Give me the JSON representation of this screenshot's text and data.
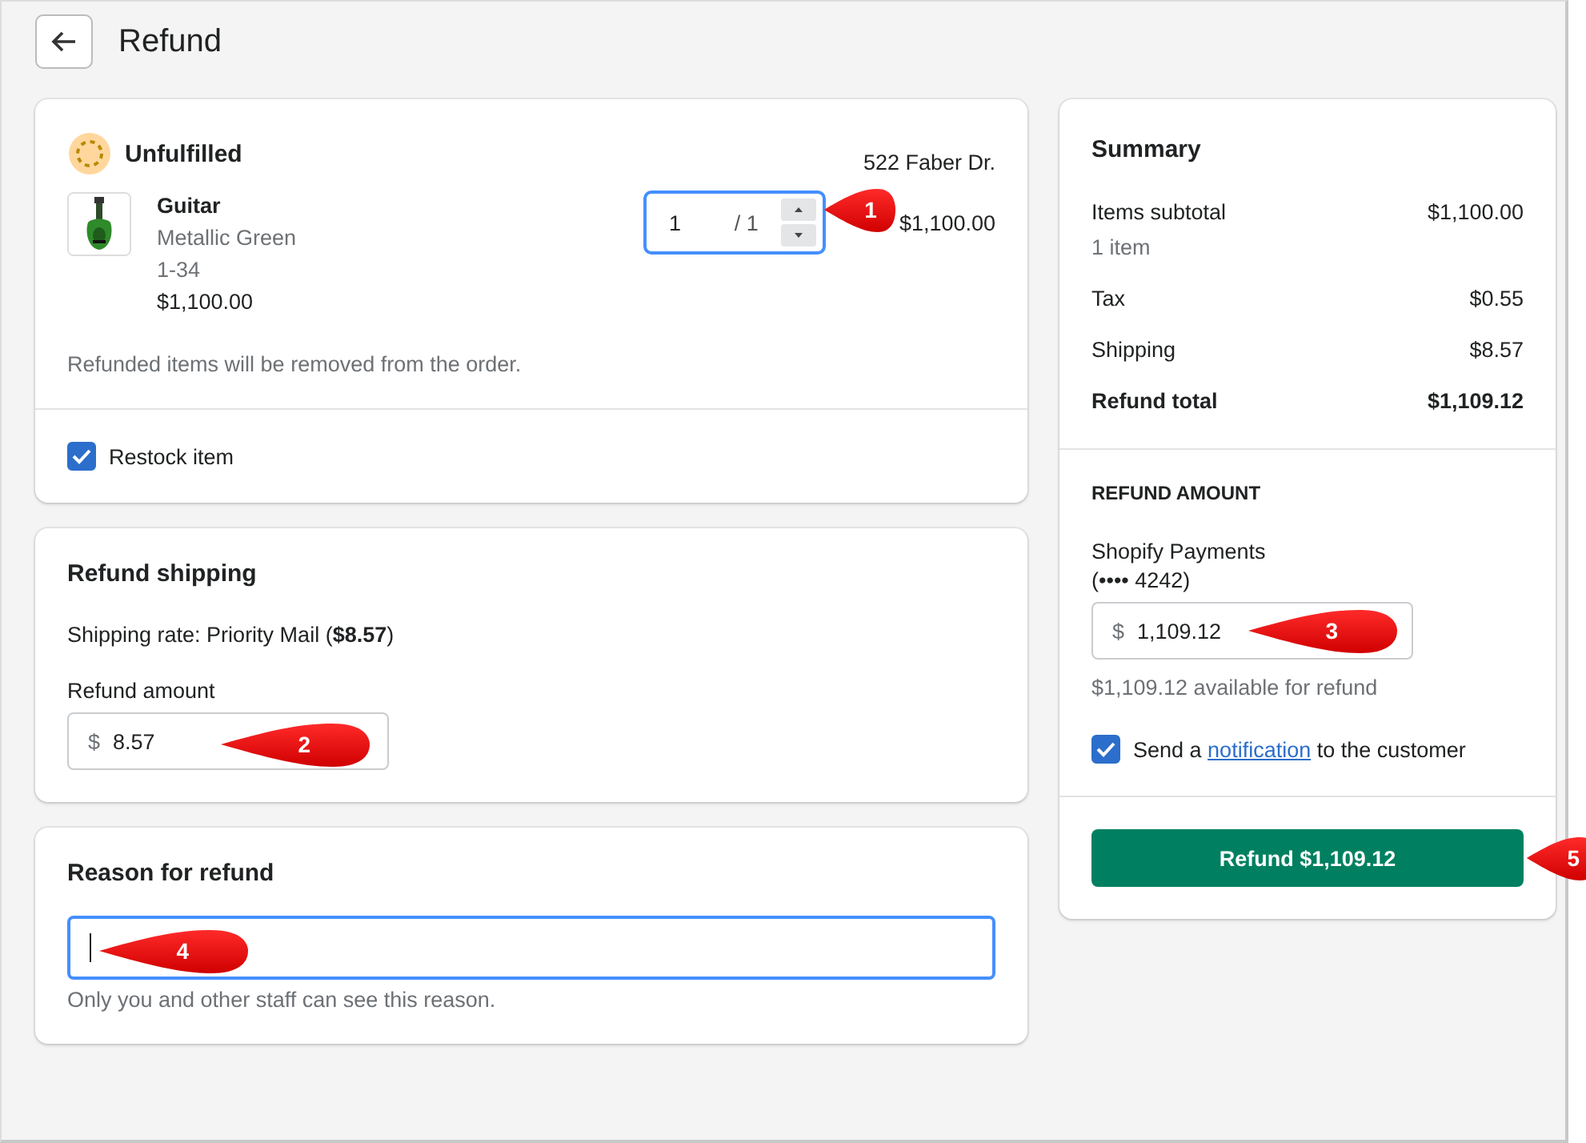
{
  "header": {
    "title": "Refund"
  },
  "items_card": {
    "status": "Unfulfilled",
    "address": "522 Faber Dr.",
    "item": {
      "name": "Guitar",
      "variant": "Metallic Green",
      "sku": "1-34",
      "price": "$1,100.00",
      "quantity": "1",
      "max": "/ 1",
      "total": "$1,100.00",
      "callout": "1"
    },
    "note": "Refunded items will be removed from the order.",
    "restock": {
      "label": "Restock item",
      "checked": true
    }
  },
  "shipping_card": {
    "title": "Refund shipping",
    "rate": "Shipping rate: Priority Mail (**$8.57**)",
    "amount_label": "Refund amount",
    "currency": "$",
    "value": "8.57",
    "callout": "2"
  },
  "reason_card": {
    "title": "Reason for refund",
    "focused": true,
    "help": "Only you and other staff can see this reason.",
    "callout": "4"
  },
  "summary": {
    "title": "Summary",
    "rows": [
      {
        "kind": "line",
        "label": "Items subtotal",
        "value": "$1,100.00",
        "sub": "1 item"
      },
      {
        "kind": "line",
        "label": "Tax",
        "value": "$0.55"
      },
      {
        "kind": "line",
        "label": "Shipping",
        "value": "$8.57"
      },
      {
        "kind": "total",
        "label": "Refund total",
        "value": "$1,109.12"
      }
    ],
    "refund_heading": "REFUND AMOUNT",
    "method": "Shopify Payments",
    "card": "(•••• 4242)",
    "currency": "$",
    "value": "1,109.12",
    "callout": "3",
    "available": "$1,109.12 available for refund",
    "notify": {
      "before": "Send a",
      "link": "notification",
      "after": "to the customer",
      "checked": true
    },
    "button": {
      "label": "Refund $1,109.12",
      "callout": "5"
    }
  }
}
